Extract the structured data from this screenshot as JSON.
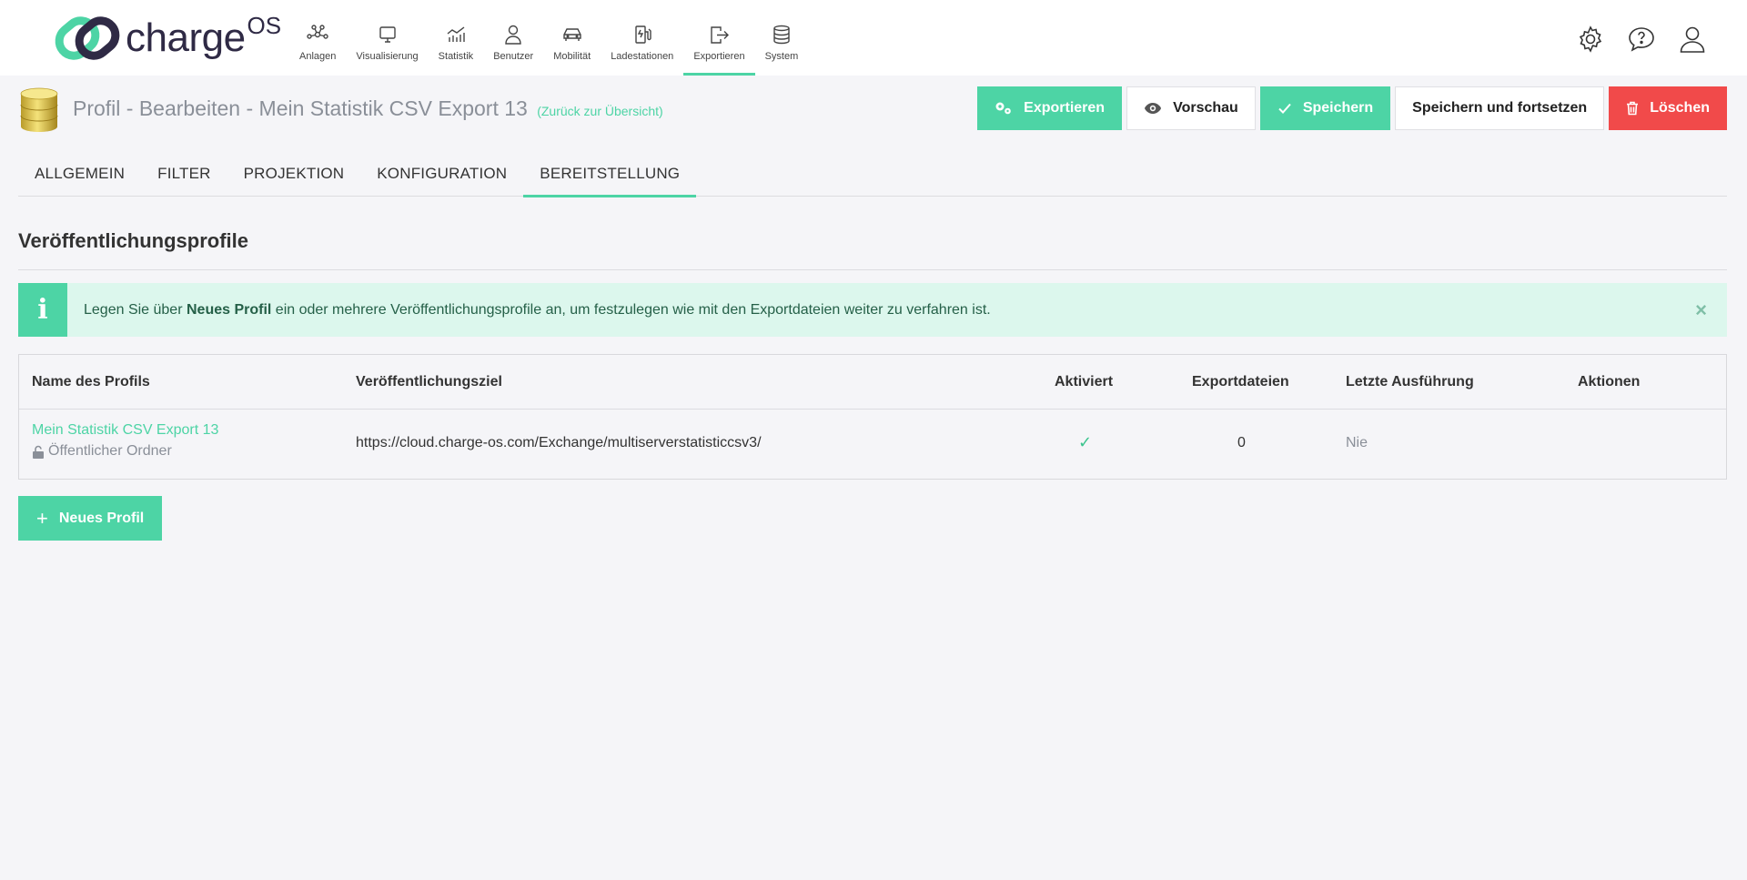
{
  "brand": {
    "name": "charge",
    "sup": "OS",
    "accent": "#4dd4a5",
    "danger": "#f14a4a"
  },
  "nav": [
    {
      "label": "Anlagen",
      "icon": "network-icon"
    },
    {
      "label": "Visualisierung",
      "icon": "monitor-icon"
    },
    {
      "label": "Statistik",
      "icon": "chart-icon"
    },
    {
      "label": "Benutzer",
      "icon": "user-icon"
    },
    {
      "label": "Mobilität",
      "icon": "car-icon"
    },
    {
      "label": "Ladestationen",
      "icon": "charger-icon"
    },
    {
      "label": "Exportieren",
      "icon": "export-icon",
      "active": true
    },
    {
      "label": "System",
      "icon": "database-icon"
    }
  ],
  "top_right_icons": [
    "gear-icon",
    "chat-help-icon",
    "user-icon"
  ],
  "header": {
    "title": "Profil - Bearbeiten - Mein Statistik CSV Export 13",
    "back_link": "(Zurück zur Übersicht)"
  },
  "actions": {
    "export": "Exportieren",
    "preview": "Vorschau",
    "save": "Speichern",
    "save_continue": "Speichern und fortsetzen",
    "delete": "Löschen"
  },
  "tabs": [
    {
      "label": "ALLGEMEIN"
    },
    {
      "label": "FILTER"
    },
    {
      "label": "PROJEKTION"
    },
    {
      "label": "KONFIGURATION"
    },
    {
      "label": "BEREITSTELLUNG",
      "active": true
    }
  ],
  "section": {
    "title": "Veröffentlichungsprofile"
  },
  "info": {
    "prefix": "Legen Sie über ",
    "bold": "Neues Profil",
    "suffix": " ein oder mehrere Veröffentlichungsprofile an, um festzulegen wie mit den Exportdateien weiter zu verfahren ist.",
    "icon_letter": "i",
    "close": "×"
  },
  "table": {
    "columns": [
      "Name des Profils",
      "Veröffentlichungsziel",
      "Aktiviert",
      "Exportdateien",
      "Letzte Ausführung",
      "Aktionen"
    ],
    "rows": [
      {
        "name": "Mein Statistik CSV Export 13",
        "sub": "Öffentlicher Ordner",
        "target": "https://cloud.charge-os.com/Exchange/multiserverstatisticcsv3/",
        "activated": "✓",
        "files": "0",
        "last_run": "Nie"
      }
    ]
  },
  "new_profile_button": "Neues Profil"
}
